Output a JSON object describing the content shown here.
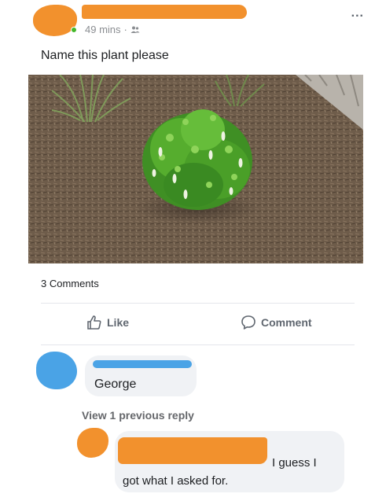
{
  "post": {
    "timestamp": "49 mins",
    "separator": "·",
    "text": "Name this plant please",
    "comments_count": "3 Comments",
    "more_label": "..."
  },
  "actions": {
    "like_label": "Like",
    "comment_label": "Comment"
  },
  "comments": [
    {
      "text": "George"
    },
    {
      "text_line1": "I guess I",
      "text_line2": "got what I asked for."
    }
  ],
  "view_previous_reply": "View 1 previous reply",
  "icons": {
    "audience": "friends-icon",
    "more": "more-options-icon",
    "like": "thumbs-up-icon",
    "comment": "speech-bubble-icon"
  },
  "colors": {
    "redact_orange": "#f2912d",
    "redact_blue": "#4aa3e6",
    "online_green": "#42b72a",
    "meta_gray": "#8a8d91"
  }
}
